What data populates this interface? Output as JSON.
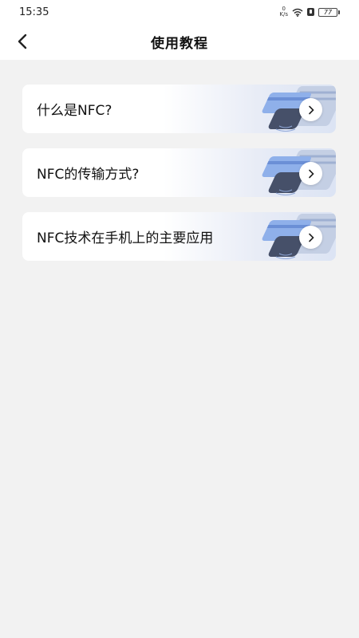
{
  "status_bar": {
    "time": "15:35",
    "speed_value": "0",
    "speed_unit": "K/s",
    "battery_level": "77",
    "icons": [
      "wifi-icon",
      "alarm-icon",
      "battery-icon"
    ]
  },
  "header": {
    "title": "使用教程",
    "back_icon": "chevron-left-icon"
  },
  "tutorials": [
    {
      "title": "什么是NFC?"
    },
    {
      "title": "NFC的传输方式?"
    },
    {
      "title": "NFC技术在手机上的主要应用"
    }
  ],
  "colors": {
    "background": "#f2f2f2",
    "card_gradient_end": "#dce4f4",
    "card_accent": "#7fa3e6"
  }
}
